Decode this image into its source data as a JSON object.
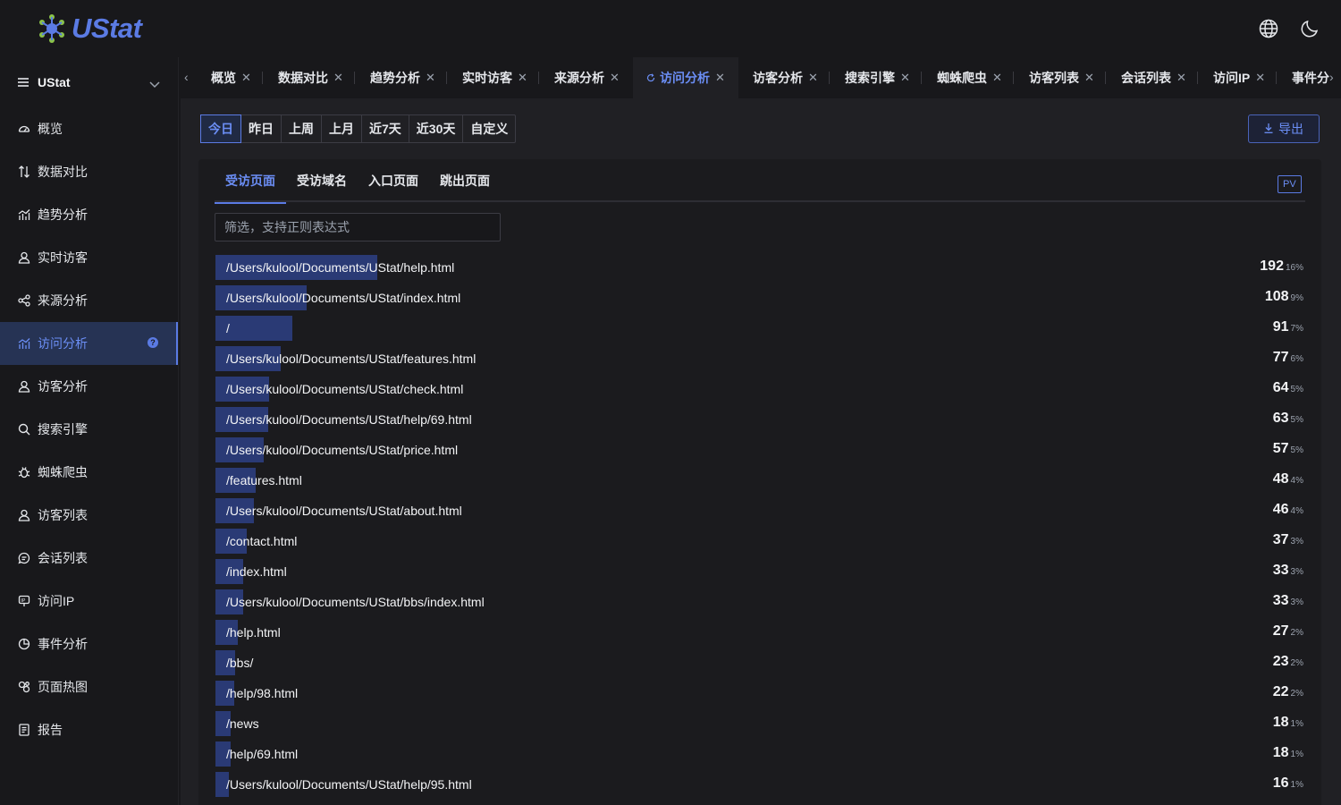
{
  "header": {
    "brand": "UStat",
    "language_icon": "globe-icon",
    "theme_icon": "moon-icon"
  },
  "sidebar": {
    "project": "UStat",
    "items": [
      {
        "label": "概览",
        "icon": "dashboard-icon"
      },
      {
        "label": "数据对比",
        "icon": "compare-icon"
      },
      {
        "label": "趋势分析",
        "icon": "trend-icon"
      },
      {
        "label": "实时访客",
        "icon": "user-icon"
      },
      {
        "label": "来源分析",
        "icon": "share-icon"
      },
      {
        "label": "访问分析",
        "icon": "chart-icon",
        "active": true
      },
      {
        "label": "访客分析",
        "icon": "user-icon"
      },
      {
        "label": "搜索引擎",
        "icon": "search-icon"
      },
      {
        "label": "蜘蛛爬虫",
        "icon": "bug-icon"
      },
      {
        "label": "访客列表",
        "icon": "user-icon"
      },
      {
        "label": "会话列表",
        "icon": "chat-icon"
      },
      {
        "label": "访问IP",
        "icon": "ip-icon"
      },
      {
        "label": "事件分析",
        "icon": "pie-icon"
      },
      {
        "label": "页面热图",
        "icon": "heatmap-icon"
      },
      {
        "label": "报告",
        "icon": "report-icon"
      }
    ]
  },
  "tabs": [
    {
      "label": "概览"
    },
    {
      "label": "数据对比"
    },
    {
      "label": "趋势分析"
    },
    {
      "label": "实时访客"
    },
    {
      "label": "来源分析"
    },
    {
      "label": "访问分析",
      "active": true
    },
    {
      "label": "访客分析"
    },
    {
      "label": "搜索引擎"
    },
    {
      "label": "蜘蛛爬虫"
    },
    {
      "label": "访客列表"
    },
    {
      "label": "会话列表"
    },
    {
      "label": "访问IP"
    },
    {
      "label": "事件分"
    }
  ],
  "toolbar": {
    "ranges": [
      "今日",
      "昨日",
      "上周",
      "上月",
      "近7天",
      "近30天",
      "自定义"
    ],
    "active_range": "今日",
    "export_label": "导出"
  },
  "panel": {
    "subtabs": [
      "受访页面",
      "受访域名",
      "入口页面",
      "跳出页面"
    ],
    "active_subtab": "受访页面",
    "metric_badge": "PV",
    "filter_placeholder": "筛选，支持正则表达式",
    "rows": [
      {
        "path": "/Users/kulool/Documents/UStat/help.html",
        "count": 192,
        "pct": "16%"
      },
      {
        "path": "/Users/kulool/Documents/UStat/index.html",
        "count": 108,
        "pct": "9%"
      },
      {
        "path": "/",
        "count": 91,
        "pct": "7%"
      },
      {
        "path": "/Users/kulool/Documents/UStat/features.html",
        "count": 77,
        "pct": "6%"
      },
      {
        "path": "/Users/kulool/Documents/UStat/check.html",
        "count": 64,
        "pct": "5%"
      },
      {
        "path": "/Users/kulool/Documents/UStat/help/69.html",
        "count": 63,
        "pct": "5%"
      },
      {
        "path": "/Users/kulool/Documents/UStat/price.html",
        "count": 57,
        "pct": "5%"
      },
      {
        "path": "/features.html",
        "count": 48,
        "pct": "4%"
      },
      {
        "path": "/Users/kulool/Documents/UStat/about.html",
        "count": 46,
        "pct": "4%"
      },
      {
        "path": "/contact.html",
        "count": 37,
        "pct": "3%"
      },
      {
        "path": "/index.html",
        "count": 33,
        "pct": "3%"
      },
      {
        "path": "/Users/kulool/Documents/UStat/bbs/index.html",
        "count": 33,
        "pct": "3%"
      },
      {
        "path": "/help.html",
        "count": 27,
        "pct": "2%"
      },
      {
        "path": "/bbs/",
        "count": 23,
        "pct": "2%"
      },
      {
        "path": "/help/98.html",
        "count": 22,
        "pct": "2%"
      },
      {
        "path": "/news",
        "count": 18,
        "pct": "1%"
      },
      {
        "path": "/help/69.html",
        "count": 18,
        "pct": "1%"
      },
      {
        "path": "/Users/kulool/Documents/UStat/help/95.html",
        "count": 16,
        "pct": "1%"
      }
    ]
  },
  "colors": {
    "accent": "#5b7be4",
    "bar": "#2a3a75",
    "background": "#18181b"
  }
}
